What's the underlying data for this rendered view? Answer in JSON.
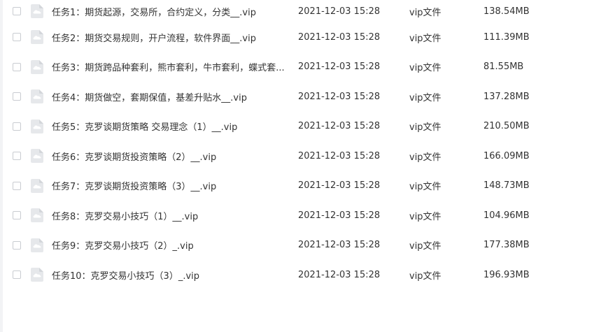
{
  "files": [
    {
      "name": "任务1：期货起源，交易所，合约定义，分类__.vip",
      "date": "2021-12-03 15:28",
      "type": "vip文件",
      "size": "138.54MB"
    },
    {
      "name": "任务2：期货交易规则，开户流程，软件界面__.vip",
      "date": "2021-12-03 15:28",
      "type": "vip文件",
      "size": "111.39MB"
    },
    {
      "name": "任务3：期货跨品种套利，熊市套利，牛市套利，蝶式套...",
      "date": "2021-12-03 15:28",
      "type": "vip文件",
      "size": "81.55MB"
    },
    {
      "name": "任务4：期货做空，套期保值，基差升贴水__.vip",
      "date": "2021-12-03 15:28",
      "type": "vip文件",
      "size": "137.28MB"
    },
    {
      "name": "任务5：克罗谈期货策略 交易理念（1）__.vip",
      "date": "2021-12-03 15:28",
      "type": "vip文件",
      "size": "210.50MB"
    },
    {
      "name": "任务6：克罗谈期货投资策略（2）__.vip",
      "date": "2021-12-03 15:28",
      "type": "vip文件",
      "size": "166.09MB"
    },
    {
      "name": "任务7：克罗谈期货投资策略（3）__.vip",
      "date": "2021-12-03 15:28",
      "type": "vip文件",
      "size": "148.73MB"
    },
    {
      "name": "任务8：克罗交易小技巧（1）__.vip",
      "date": "2021-12-03 15:28",
      "type": "vip文件",
      "size": "104.96MB"
    },
    {
      "name": "任务9：克罗交易小技巧（2）_.vip",
      "date": "2021-12-03 15:28",
      "type": "vip文件",
      "size": "177.38MB"
    },
    {
      "name": "任务10：克罗交易小技巧（3）_.vip",
      "date": "2021-12-03 15:28",
      "type": "vip文件",
      "size": "196.93MB"
    }
  ],
  "icons": {
    "file": "cloud-file-icon",
    "checkbox": "checkbox"
  },
  "colors": {
    "text": "#333333",
    "icon_fill": "#e6e8eb",
    "checkbox_border": "#c9ccd1"
  }
}
